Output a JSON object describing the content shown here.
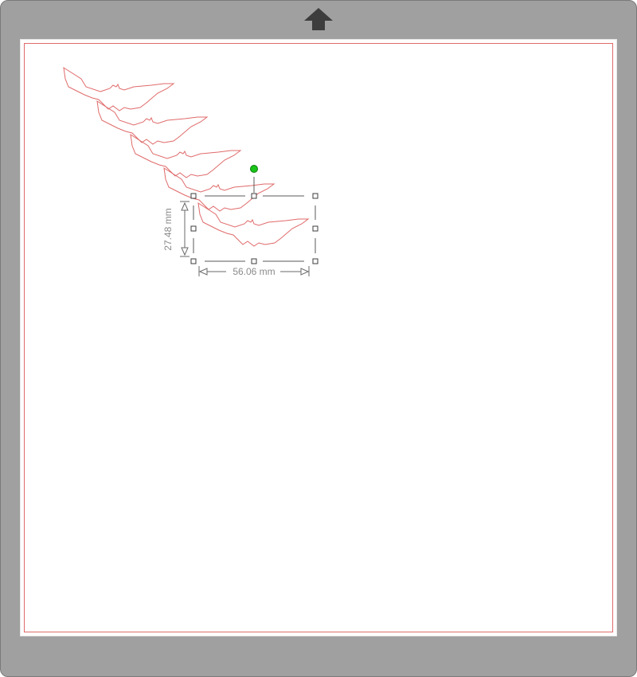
{
  "canvas": {
    "dimensions": {
      "width_label": "56.06 mm",
      "height_label": "27.48 mm"
    }
  },
  "colors": {
    "mat": "#a0a0a0",
    "cut_line": "#e06a6a",
    "rotate_handle": "#19c419",
    "arrow": "#3d3d3d"
  },
  "icons": {
    "load_arrow": "arrow-up-icon",
    "rotate": "rotate-handle-icon"
  }
}
